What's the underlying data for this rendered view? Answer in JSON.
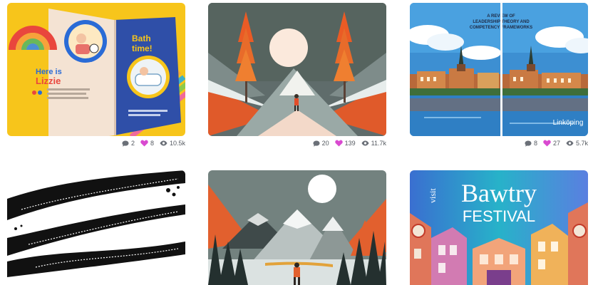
{
  "colors": {
    "heart": "#d94ad0",
    "icon_gray": "#6b7078",
    "stat_text": "#555a61"
  },
  "cards": [
    {
      "texts": {
        "book_title_left": "Here is",
        "book_name_left": "Lizzie",
        "book_title_right": "Bath",
        "book_title_right_2": "time!"
      },
      "stats": {
        "comments": "2",
        "likes": "8",
        "views": "10.5k"
      }
    },
    {
      "stats": {
        "comments": "20",
        "likes": "139",
        "views": "11.7k"
      }
    },
    {
      "texts": {
        "line1": "A REVIEW OF",
        "line2": "LEADERSHIP THEORY AND",
        "line3": "COMPETENCY FRAMEWORKS",
        "city": "Linköping"
      },
      "stats": {
        "comments": "8",
        "likes": "27",
        "views": "5.7k"
      }
    },
    {},
    {},
    {
      "texts": {
        "visit": "visit",
        "name": "Bawtry",
        "festival": "FESTIVAL"
      }
    }
  ]
}
